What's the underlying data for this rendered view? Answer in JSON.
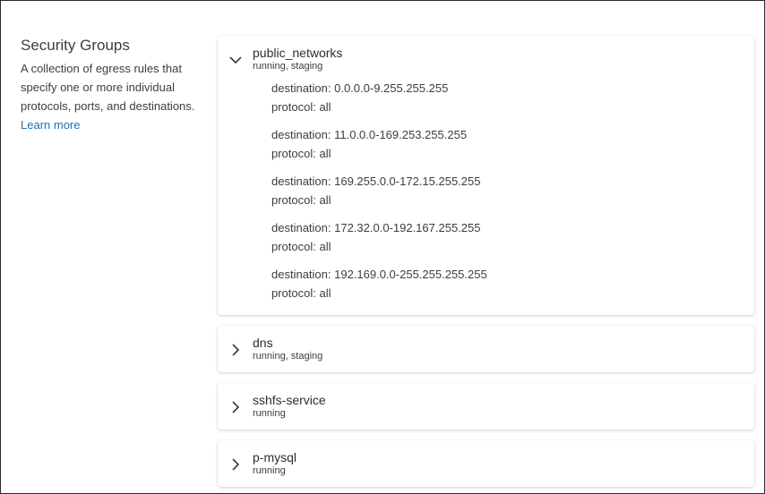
{
  "section": {
    "title": "Security Groups",
    "description": "A collection of egress rules that specify one or more individual protocols, ports, and destinations.",
    "learn_more": "Learn more"
  },
  "groups": [
    {
      "name": "public_networks",
      "lifecycle": "running, staging",
      "expanded": true,
      "rules": [
        {
          "destination": "destination: 0.0.0.0-9.255.255.255",
          "protocol": "protocol: all"
        },
        {
          "destination": "destination: 11.0.0.0-169.253.255.255",
          "protocol": "protocol: all"
        },
        {
          "destination": "destination: 169.255.0.0-172.15.255.255",
          "protocol": "protocol: all"
        },
        {
          "destination": "destination: 172.32.0.0-192.167.255.255",
          "protocol": "protocol: all"
        },
        {
          "destination": "destination: 192.169.0.0-255.255.255.255",
          "protocol": "protocol: all"
        }
      ]
    },
    {
      "name": "dns",
      "lifecycle": "running, staging",
      "expanded": false
    },
    {
      "name": "sshfs-service",
      "lifecycle": "running",
      "expanded": false
    },
    {
      "name": "p-mysql",
      "lifecycle": "running",
      "expanded": false
    }
  ],
  "icons": {
    "expanded": "chevron-down-icon",
    "collapsed": "chevron-right-icon"
  },
  "colors": {
    "link": "#1a73b5",
    "text": "#3d3d3d"
  }
}
